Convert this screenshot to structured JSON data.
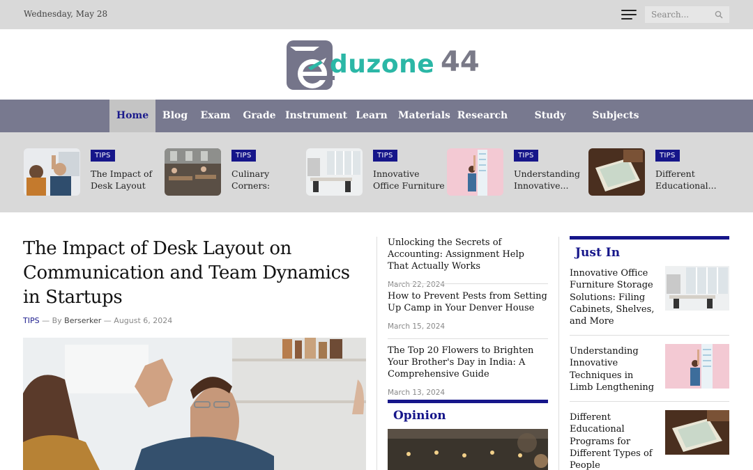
{
  "topbar": {
    "date": "Wednesday, May 28",
    "search_placeholder": "Search..."
  },
  "logo": {
    "text": "duzone",
    "number": "44",
    "brand_color": "#2bb7a6",
    "icon_color": "#75758a"
  },
  "nav": {
    "items": [
      "Home",
      "Blog",
      "Exam",
      "Grade",
      "Instrument",
      "Learn",
      "Materials",
      "Research",
      "Study Abroad",
      "Subjects"
    ],
    "active": "Home",
    "bg_color": "#78798f"
  },
  "featured": [
    {
      "badge": "TIPS",
      "title": "The Impact of Desk Layout on..."
    },
    {
      "badge": "TIPS",
      "title": "Culinary Corners: Apartments in..."
    },
    {
      "badge": "TIPS",
      "title": "Innovative Office Furniture Storag..."
    },
    {
      "badge": "TIPS",
      "title": "Understanding Innovative..."
    },
    {
      "badge": "TIPS",
      "title": "Different Educational..."
    }
  ],
  "main": {
    "title": "The Impact of Desk Layout on Communication and Team Dynamics in Startups",
    "category": "TIPS",
    "by": "— By",
    "author": "Berserker",
    "date": "— August 6, 2024"
  },
  "middle": {
    "posts": [
      {
        "title": "Unlocking the Secrets of Accounting: Assignment Help That Actually Works",
        "date": "March 22, 2024"
      },
      {
        "title": "How to Prevent Pests from Setting Up Camp in Your Denver House",
        "date": "March 15, 2024"
      },
      {
        "title": "The Top 20 Flowers to Brighten Your Brother's Day in India: A Comprehensive Guide",
        "date": "March 13, 2024"
      }
    ],
    "opinion_heading": "Opinion"
  },
  "sidebar": {
    "heading": "Just In",
    "posts": [
      {
        "title": "Innovative Office Furniture Storage Solutions: Filing Cabinets, Shelves, and More"
      },
      {
        "title": "Understanding Innovative Techniques in Limb Lengthening"
      },
      {
        "title": "Different Educational Programs for Different Types of People"
      }
    ]
  },
  "accent_color": "#16168a"
}
